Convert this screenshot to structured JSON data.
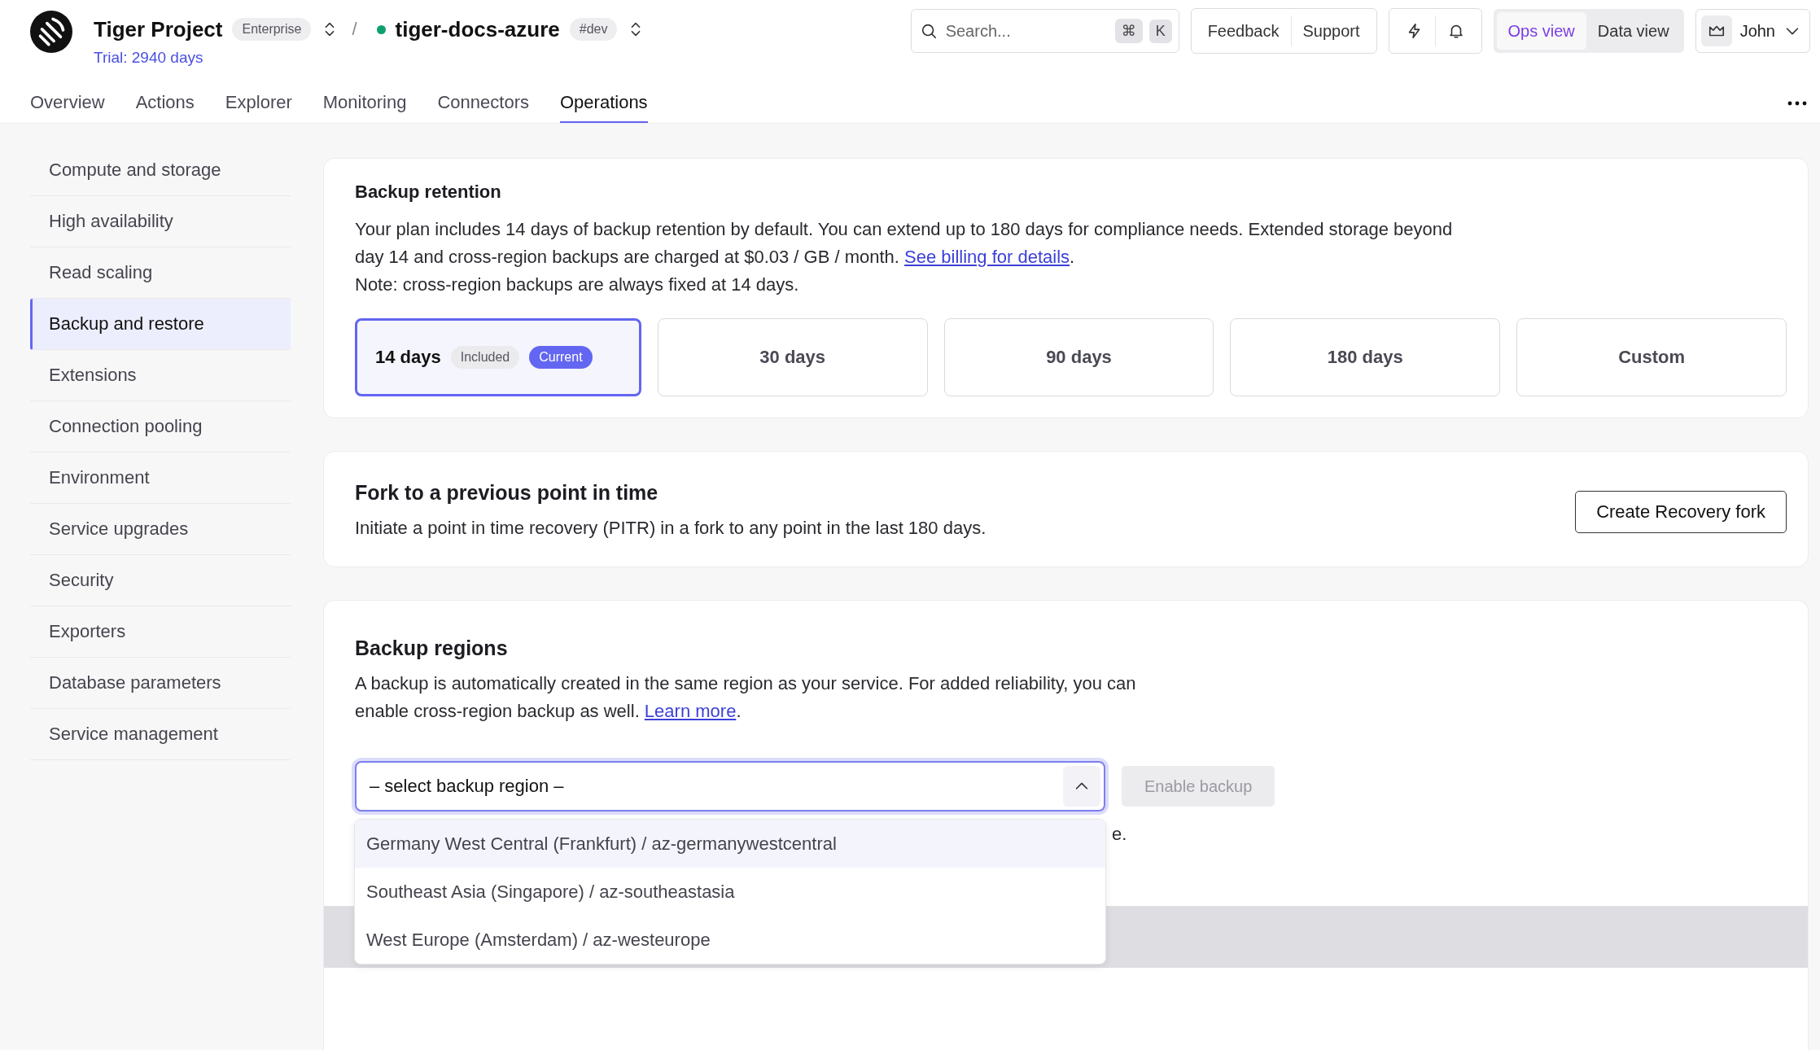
{
  "header": {
    "project": "Tiger Project",
    "plan_badge": "Enterprise",
    "trial": "Trial: 2940 days",
    "service": "tiger-docs-azure",
    "service_online": true,
    "env_tag": "#dev",
    "separator": "/"
  },
  "nav_tabs": [
    {
      "label": "Overview",
      "selected": false
    },
    {
      "label": "Actions",
      "selected": false
    },
    {
      "label": "Explorer",
      "selected": false
    },
    {
      "label": "Monitoring",
      "selected": false
    },
    {
      "label": "Connectors",
      "selected": false
    },
    {
      "label": "Operations",
      "selected": true
    }
  ],
  "search": {
    "placeholder": "Search...",
    "shortcut_keys": [
      "⌘",
      "K"
    ]
  },
  "header_buttons": [
    "Feedback",
    "Support"
  ],
  "view_switch": [
    {
      "label": "Ops view",
      "selected": true
    },
    {
      "label": "Data view",
      "selected": false
    }
  ],
  "user": {
    "name": "John"
  },
  "sidebar": {
    "items": [
      {
        "label": "Compute and storage",
        "selected": false
      },
      {
        "label": "High availability",
        "selected": false
      },
      {
        "label": "Read scaling",
        "selected": false
      },
      {
        "label": "Backup and restore",
        "selected": true
      },
      {
        "label": "Extensions",
        "selected": false
      },
      {
        "label": "Connection pooling",
        "selected": false
      },
      {
        "label": "Environment",
        "selected": false
      },
      {
        "label": "Service upgrades",
        "selected": false
      },
      {
        "label": "Security",
        "selected": false
      },
      {
        "label": "Exporters",
        "selected": false
      },
      {
        "label": "Database parameters",
        "selected": false
      },
      {
        "label": "Service management",
        "selected": false
      }
    ]
  },
  "backup_retention": {
    "title": "Backup retention",
    "description": "Your plan includes 14 days of backup retention by default. You can extend up to 180 days for compliance needs. Extended storage beyond day 14 and cross-region backups are charged at $0.03 / GB / month. ",
    "link": "See billing for details",
    "description_end": ".",
    "note": "Note: cross-region backups are always fixed at 14 days.",
    "options": [
      {
        "label": "14 days",
        "selected": true,
        "tags": [
          {
            "label": "Included",
            "kind": "neutral"
          },
          {
            "label": "Current",
            "kind": "current"
          }
        ]
      },
      {
        "label": "30 days",
        "selected": false
      },
      {
        "label": "90 days",
        "selected": false
      },
      {
        "label": "180 days",
        "selected": false
      },
      {
        "label": "Custom",
        "selected": false
      }
    ]
  },
  "fork": {
    "title": "Fork to a previous point in time",
    "description": "Initiate a point in time recovery (PITR) in a fork to any point in the last 180 days.",
    "button": "Create Recovery fork"
  },
  "backup_regions": {
    "title": "Backup regions",
    "description": "A backup is automatically created in the same region as your service. For added reliability, you can enable cross-region backup as well. ",
    "link": "Learn more",
    "description_end": ".",
    "select": {
      "placeholder": "– select backup region –",
      "expanded": true
    },
    "enable_button": {
      "label": "Enable backup",
      "disabled": true
    },
    "hidden_text_tail": "e.",
    "options": [
      {
        "label": "Germany West Central (Frankfurt) / az-germanywestcentral",
        "selected": true
      },
      {
        "label": "Southeast Asia (Singapore) / az-southeastasia",
        "selected": false
      },
      {
        "label": "West Europe (Amsterdam) / az-westeurope",
        "selected": false
      }
    ]
  }
}
